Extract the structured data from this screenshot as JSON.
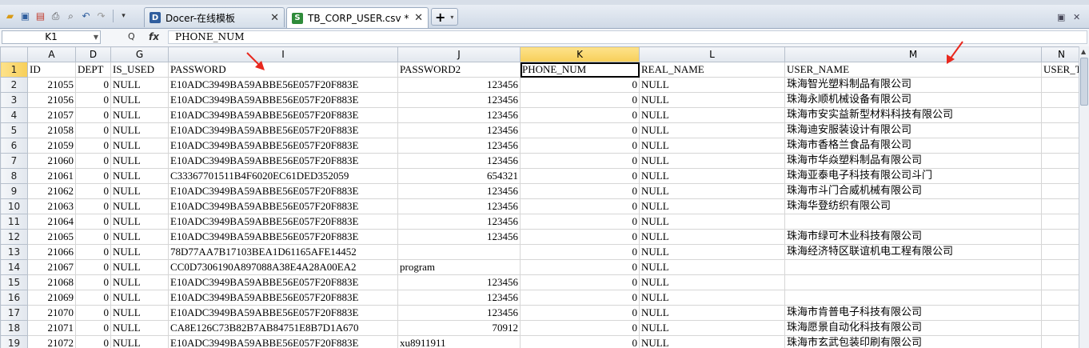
{
  "tabs": [
    {
      "label": "Docer-在线模板",
      "icon": "docer-icon",
      "active": false
    },
    {
      "label": "TB_CORP_USER.csv *",
      "icon": "spreadsheet-icon",
      "active": true
    }
  ],
  "new_tab_label": "+",
  "formula_bar": {
    "name_box": "K1",
    "zoom_symbol": "Q",
    "fx_symbol": "fx",
    "content": "PHONE_NUM"
  },
  "columns": [
    {
      "letter": "A",
      "width": 60
    },
    {
      "letter": "D",
      "width": 44
    },
    {
      "letter": "G",
      "width": 72
    },
    {
      "letter": "I",
      "width": 287
    },
    {
      "letter": "J",
      "width": 153
    },
    {
      "letter": "K",
      "width": 149
    },
    {
      "letter": "L",
      "width": 182
    },
    {
      "letter": "M",
      "width": 321
    },
    {
      "letter": "N",
      "width": 50
    }
  ],
  "selected_column": "K",
  "selected_row": "1",
  "rows": [
    {
      "num": "1",
      "cells": [
        "ID",
        "DEPT",
        "IS_USED",
        "PASSWORD",
        "PASSWORD2",
        "PHONE_NUM",
        "REAL_NAME",
        "USER_NAME",
        "USER_T"
      ]
    },
    {
      "num": "2",
      "cells": [
        "21055",
        "0",
        "NULL",
        "E10ADC3949BA59ABBE56E057F20F883E",
        "123456",
        "0",
        "NULL",
        "珠海智光塑料制品有限公司",
        ""
      ]
    },
    {
      "num": "3",
      "cells": [
        "21056",
        "0",
        "NULL",
        "E10ADC3949BA59ABBE56E057F20F883E",
        "123456",
        "0",
        "NULL",
        "珠海永顺机械设备有限公司",
        ""
      ]
    },
    {
      "num": "4",
      "cells": [
        "21057",
        "0",
        "NULL",
        "E10ADC3949BA59ABBE56E057F20F883E",
        "123456",
        "0",
        "NULL",
        "珠海市安实益新型材料科技有限公司",
        ""
      ]
    },
    {
      "num": "5",
      "cells": [
        "21058",
        "0",
        "NULL",
        "E10ADC3949BA59ABBE56E057F20F883E",
        "123456",
        "0",
        "NULL",
        "珠海迪安服装设计有限公司",
        ""
      ]
    },
    {
      "num": "6",
      "cells": [
        "21059",
        "0",
        "NULL",
        "E10ADC3949BA59ABBE56E057F20F883E",
        "123456",
        "0",
        "NULL",
        "珠海市香格兰食品有限公司",
        ""
      ]
    },
    {
      "num": "7",
      "cells": [
        "21060",
        "0",
        "NULL",
        "E10ADC3949BA59ABBE56E057F20F883E",
        "123456",
        "0",
        "NULL",
        "珠海市华焱塑料制品有限公司",
        ""
      ]
    },
    {
      "num": "8",
      "cells": [
        "21061",
        "0",
        "NULL",
        "C33367701511B4F6020EC61DED352059",
        "654321",
        "0",
        "NULL",
        "珠海亚泰电子科技有限公司斗门",
        ""
      ]
    },
    {
      "num": "9",
      "cells": [
        "21062",
        "0",
        "NULL",
        "E10ADC3949BA59ABBE56E057F20F883E",
        "123456",
        "0",
        "NULL",
        "珠海市斗门合威机械有限公司",
        ""
      ]
    },
    {
      "num": "10",
      "cells": [
        "21063",
        "0",
        "NULL",
        "E10ADC3949BA59ABBE56E057F20F883E",
        "123456",
        "0",
        "NULL",
        "珠海华登纺织有限公司",
        ""
      ]
    },
    {
      "num": "11",
      "cells": [
        "21064",
        "0",
        "NULL",
        "E10ADC3949BA59ABBE56E057F20F883E",
        "123456",
        "0",
        "NULL",
        "",
        ""
      ]
    },
    {
      "num": "12",
      "cells": [
        "21065",
        "0",
        "NULL",
        "E10ADC3949BA59ABBE56E057F20F883E",
        "123456",
        "0",
        "NULL",
        "珠海市绿可木业科技有限公司",
        ""
      ]
    },
    {
      "num": "13",
      "cells": [
        "21066",
        "0",
        "NULL",
        "78D77AA7B17103BEA1D61165AFE14452",
        "",
        "0",
        "NULL",
        "珠海经济特区联谊机电工程有限公司",
        ""
      ]
    },
    {
      "num": "14",
      "cells": [
        "21067",
        "0",
        "NULL",
        "CC0D7306190A897088A38E4A28A00EA2",
        "program",
        "0",
        "NULL",
        "",
        ""
      ]
    },
    {
      "num": "15",
      "cells": [
        "21068",
        "0",
        "NULL",
        "E10ADC3949BA59ABBE56E057F20F883E",
        "123456",
        "0",
        "NULL",
        "",
        ""
      ]
    },
    {
      "num": "16",
      "cells": [
        "21069",
        "0",
        "NULL",
        "E10ADC3949BA59ABBE56E057F20F883E",
        "123456",
        "0",
        "NULL",
        "",
        ""
      ]
    },
    {
      "num": "17",
      "cells": [
        "21070",
        "0",
        "NULL",
        "E10ADC3949BA59ABBE56E057F20F883E",
        "123456",
        "0",
        "NULL",
        "珠海市肯普电子科技有限公司",
        ""
      ]
    },
    {
      "num": "18",
      "cells": [
        "21071",
        "0",
        "NULL",
        "CA8E126C73B82B7AB84751E8B7D1A670",
        "70912",
        "0",
        "NULL",
        "珠海愿景自动化科技有限公司",
        ""
      ]
    },
    {
      "num": "19",
      "cells": [
        "21072",
        "0",
        "NULL",
        "E10ADC3949BA59ABBE56E057F20F883E",
        "xu8911911",
        "0",
        "NULL",
        "珠海市玄武包装印刷有限公司",
        ""
      ]
    }
  ],
  "colors": {
    "selection_header": "#f7cf59",
    "annotation_arrow": "#e8281e",
    "toolbar_bg": "#cfd9e6"
  }
}
